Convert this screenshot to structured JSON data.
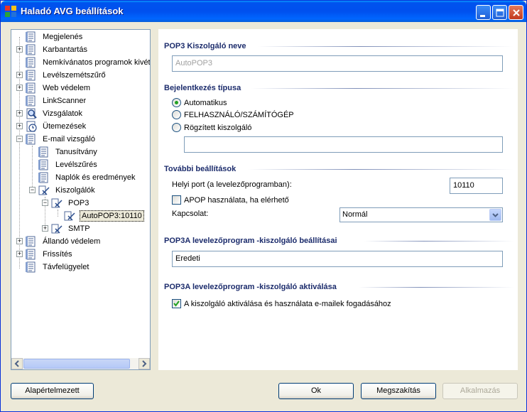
{
  "window": {
    "title": "Haladó AVG beállítások"
  },
  "tree": {
    "items": [
      {
        "label": "Megjelenés"
      },
      {
        "label": "Karbantartás"
      },
      {
        "label": "Nemkívánatos programok kivéte"
      },
      {
        "label": "Levélszemétszűrő"
      },
      {
        "label": "Web védelem"
      },
      {
        "label": "LinkScanner"
      },
      {
        "label": "Vizsgálatok"
      },
      {
        "label": "Ütemezések"
      },
      {
        "label": "E-mail vizsgáló"
      },
      {
        "label": "Tanusítvány"
      },
      {
        "label": "Levélszűrés"
      },
      {
        "label": "Naplók és eredmények"
      },
      {
        "label": "Kiszolgálók"
      },
      {
        "label": "POP3"
      },
      {
        "label": "AutoPOP3:10110"
      },
      {
        "label": "SMTP"
      },
      {
        "label": "Állandó védelem"
      },
      {
        "label": "Frissítés"
      },
      {
        "label": "Távfelügyelet"
      }
    ]
  },
  "server_name": {
    "heading": "POP3 Kiszolgáló neve",
    "value": "AutoPOP3"
  },
  "login_type": {
    "heading": "Bejelentkezés típusa",
    "options": [
      "Automatikus",
      "FELHASZNÁLÓ/SZÁMÍTÓGÉP",
      "Rögzített kiszolgáló"
    ],
    "selected": "Automatikus",
    "fixed_server_value": ""
  },
  "additional": {
    "heading": "További beállítások",
    "port_label": "Helyi port (a levelezőprogramban):",
    "port_value": "10110",
    "apop_label": "APOP használata, ha elérhető",
    "apop_checked": false,
    "connection_label": "Kapcsolat:",
    "connection_value": "Normál"
  },
  "pop3a_settings": {
    "heading": "POP3A levelezőprogram -kiszolgáló beállításai",
    "value": "Eredeti"
  },
  "pop3a_activation": {
    "heading": "POP3A levelezőprogram -kiszolgáló aktiválása",
    "checkbox_label": "A kiszolgáló aktiválása és használata e-mailek fogadásához",
    "checked": true
  },
  "buttons": {
    "defaults": "Alapértelmezett",
    "ok": "Ok",
    "cancel": "Megszakítás",
    "apply": "Alkalmazás"
  }
}
